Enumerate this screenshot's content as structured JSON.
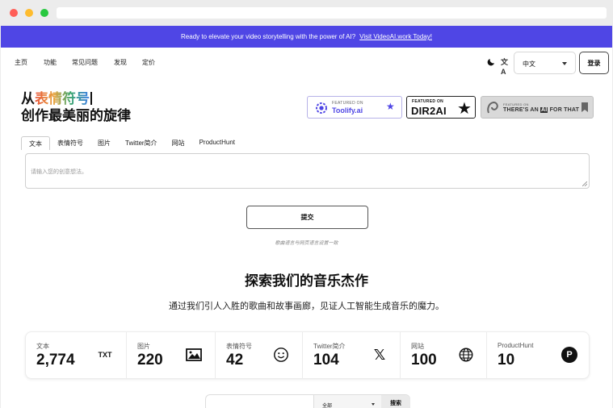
{
  "banner": {
    "text": "Ready to elevate your video storytelling with the power of AI?",
    "link": "Visit VideoAI.work Today!"
  },
  "nav": {
    "items": [
      "主页",
      "功能",
      "常见问题",
      "发现",
      "定价"
    ],
    "language": "中文",
    "login": "登录",
    "translate_glyph": "文A"
  },
  "hero": {
    "prefix": "从",
    "emoji_word": "表情符号",
    "line2": "创作最美丽的旋律"
  },
  "badges": {
    "toolify_small": "FEATURED ON",
    "toolify_name": "Toolify.ai",
    "dir2ai_small": "FEATURED ON",
    "dir2ai_name": "DIR2AI",
    "taaft_small": "FEATURED ON",
    "taaft_name_1": "THERE'S AN",
    "taaft_name_ai": "AI",
    "taaft_name_2": "FOR THAT"
  },
  "tabs": [
    "文本",
    "表情符号",
    "图片",
    "Twitter简介",
    "网站",
    "ProductHunt"
  ],
  "active_tab": "文本",
  "input": {
    "placeholder": "请输入您的创意想法。"
  },
  "submit_label": "提交",
  "note": "歌曲语言与网页语言设置一致",
  "section": {
    "title": "探索我们的音乐杰作",
    "subtitle": "通过我们引人入胜的歌曲和故事画廊，见证人工智能生成音乐的魔力。"
  },
  "stats": [
    {
      "label": "文本",
      "value": "2,774",
      "icon": "txt-icon",
      "icon_text": "TXT"
    },
    {
      "label": "图片",
      "value": "220",
      "icon": "image-icon"
    },
    {
      "label": "表情符号",
      "value": "42",
      "icon": "smiley-icon"
    },
    {
      "label": "Twitter简介",
      "value": "104",
      "icon": "x-logo-icon",
      "icon_text": "𝕏"
    },
    {
      "label": "网站",
      "value": "100",
      "icon": "globe-icon"
    },
    {
      "label": "ProductHunt",
      "value": "10",
      "icon": "producthunt-icon",
      "icon_text": "P"
    }
  ],
  "filter": {
    "selected": "全部",
    "search_label": "搜索"
  },
  "colors": {
    "brand": "#4f46e5"
  }
}
